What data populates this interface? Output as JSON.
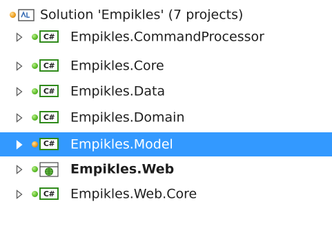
{
  "solution": {
    "label": "Solution 'Empikles' (7 projects)"
  },
  "projects": [
    {
      "label": "Empikles.CommandProcessor",
      "icon": "csharp-project-icon",
      "status": "green"
    },
    {
      "label": "Empikles.Core",
      "icon": "csharp-project-icon",
      "status": "green"
    },
    {
      "label": "Empikles.Data",
      "icon": "csharp-project-icon",
      "status": "green"
    },
    {
      "label": "Empikles.Domain",
      "icon": "csharp-project-icon",
      "status": "green"
    },
    {
      "label": "Empikles.Model",
      "icon": "csharp-project-icon",
      "status": "orange",
      "selected": true
    },
    {
      "label": "Empikles.Web",
      "icon": "web-project-icon",
      "status": "green",
      "bold": true
    },
    {
      "label": "Empikles.Web.Core",
      "icon": "csharp-project-icon",
      "status": "green"
    }
  ],
  "icons": {
    "csharp_text": "C#"
  },
  "colors": {
    "selection": "#3399ff",
    "status_green": "#5fbf2a",
    "status_orange": "#f0a020",
    "project_border": "#2f8a1a"
  }
}
